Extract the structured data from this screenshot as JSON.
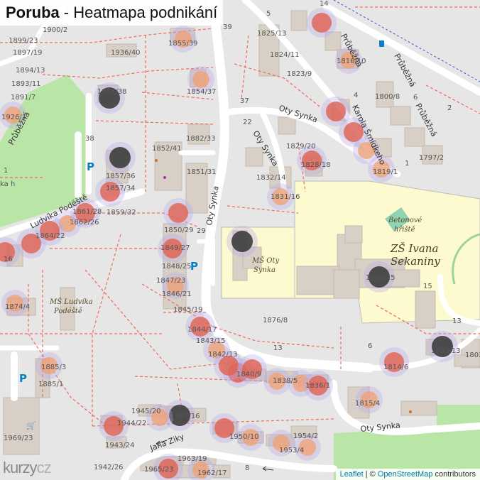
{
  "header": {
    "place": "Poruba",
    "separator": "-",
    "subtitle": "Heatmapa podnikání"
  },
  "attribution": {
    "leaflet": "Leaflet",
    "sep": "|",
    "copyright": "©",
    "osm": "OpenStreetMap",
    "contributors": "contributors"
  },
  "logo": {
    "text1": "kurzy",
    "text2": "cz"
  },
  "colors": {
    "background": "#e6e6e6",
    "building": "#d8cfc6",
    "school": "#fdfad0",
    "park": "#b9e6a6",
    "road": "#ffffff",
    "path": "#f06a5a",
    "heat_low": "#f0a070",
    "heat_mid": "#e06050",
    "heat_high": "#404040"
  },
  "roads": [
    {
      "label": "Průběžná"
    },
    {
      "label": "Průběžná"
    },
    {
      "label": "Průběžná"
    },
    {
      "label": "Průběžná"
    },
    {
      "label": "Oty Synka"
    },
    {
      "label": "Oty Synka"
    },
    {
      "label": "Oty Synka"
    },
    {
      "label": "Oty Synka"
    },
    {
      "label": "Karola Šmídkeho"
    },
    {
      "label": "Ludvíka Podéště"
    },
    {
      "label": "Jana Ziky"
    }
  ],
  "pois": [
    {
      "label": "MŠ Oty",
      "label2": "Synka"
    },
    {
      "label": "MŠ Ludvíka",
      "label2": "Podéště"
    },
    {
      "label": "Betonové",
      "label2": "hřiště"
    },
    {
      "label": "ZŠ Ivana",
      "label2": "Sekaniny"
    }
  ],
  "house_numbers": [
    "1900/2",
    "1899/23",
    "1897/19",
    "1894/13",
    "1893/11",
    "1891/7",
    "1926/1",
    "1936/40",
    "1855/39",
    "1825/13",
    "1824/11",
    "1823/9",
    "1856/38",
    "1854/37",
    "1882/33",
    "1852/41",
    "1851/31",
    "1857/36",
    "1857/34",
    "1859/32",
    "1861/28",
    "1862/26",
    "1864/22",
    "1850/29",
    "1849/27",
    "1848/25",
    "1847/23",
    "1846/21",
    "1845/19",
    "1844/17",
    "1843/15",
    "1842/13",
    "1840/9",
    "1838/5",
    "1836/1",
    "1829/20",
    "1828/18",
    "1832/14",
    "1831/16",
    "1816/10",
    "1800/8",
    "1797/2",
    "1819/1",
    "1804/15",
    "1876/8",
    "1874/4",
    "1885/3",
    "1885/1",
    "1815/4",
    "1803/13",
    "1802",
    "1814/6",
    "1945/20",
    "1947/16",
    "1944/22",
    "1950/10",
    "1954/2",
    "1953/4",
    "1943/24",
    "1942/26",
    "1965/23",
    "1963/19",
    "1962/17",
    "1969/23",
    "16",
    "1",
    "39",
    "37",
    "22",
    "29",
    "38",
    "14",
    "5",
    "4",
    "6",
    "2",
    "1",
    "15",
    "13",
    "6",
    "13",
    "8",
    "P",
    "P",
    "P",
    "ka",
    "h"
  ],
  "heat_levels": [
    "low",
    "low",
    "mid",
    "high",
    "low",
    "mid",
    "low",
    "high",
    "mid",
    "low",
    "mid",
    "low",
    "mid",
    "high",
    "mid",
    "mid",
    "low",
    "mid",
    "low",
    "high",
    "low",
    "mid",
    "mid",
    "mid",
    "mid",
    "low",
    "high",
    "low",
    "mid",
    "low",
    "high",
    "mid",
    "mid",
    "low",
    "low",
    "mid",
    "low",
    "low",
    "low",
    "low",
    "mid",
    "mid",
    "low",
    "mid",
    "mid",
    "low"
  ]
}
